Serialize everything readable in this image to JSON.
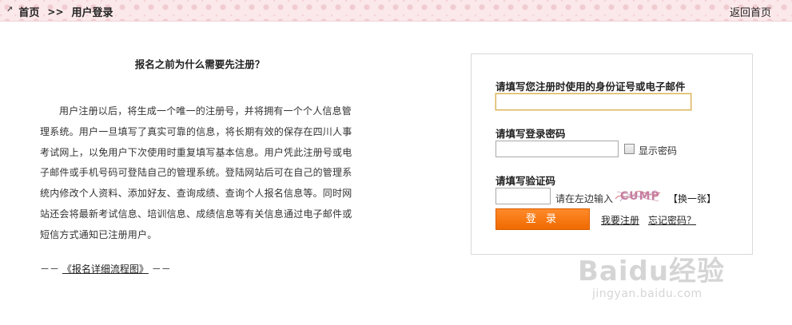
{
  "topbar": {
    "arrow_icon": "arrow-up-right-icon",
    "home_label": "首页",
    "separator": ">>",
    "current_label": "用户登录",
    "back_home_label": "返回首页"
  },
  "intro": {
    "title": "报名之前为什么需要先注册？",
    "paragraph": "用户注册以后，将生成一个唯一的注册号，并将拥有一个个人信息管理系统。用户一旦填写了真实可靠的信息，将长期有效的保存在四川人事考试网上，以免用户下次使用时重复填写基本信息。用户凭此注册号或电子邮件或手机号码可登陆自己的管理系统。登陆网站后可在自己的管理系统内修改个人资料、添加好友、查询成绩、查询个人报名信息等。同时网站还会将最新考试信息、培训信息、成绩信息等有关信息通过电子邮件或短信方式通知已注册用户。",
    "flow_prefix": "－－",
    "flow_link": "《报名详细流程图》",
    "flow_suffix": "－－"
  },
  "login": {
    "id_label": "请填写您注册时使用的身份证号或电子邮件",
    "id_value": "",
    "password_label": "请填写登录密码",
    "password_value": "",
    "show_password_label": "显示密码",
    "show_password_checked": false,
    "captcha_label": "请填写验证码",
    "captcha_value": "",
    "captcha_hint": "请在左边输入",
    "captcha_text": "CUMP",
    "change_label": "【换一张】",
    "login_button": "登 录",
    "register_link": "我要注册",
    "forgot_link": "忘记密码？"
  },
  "watermark": {
    "logo_text": "Baidu经验",
    "sub_text": "jingyan.baidu.com"
  },
  "colors": {
    "topbar_bg": "#fbe8ea",
    "button_orange": "#f47a13",
    "focus_border": "#d7b15a"
  }
}
